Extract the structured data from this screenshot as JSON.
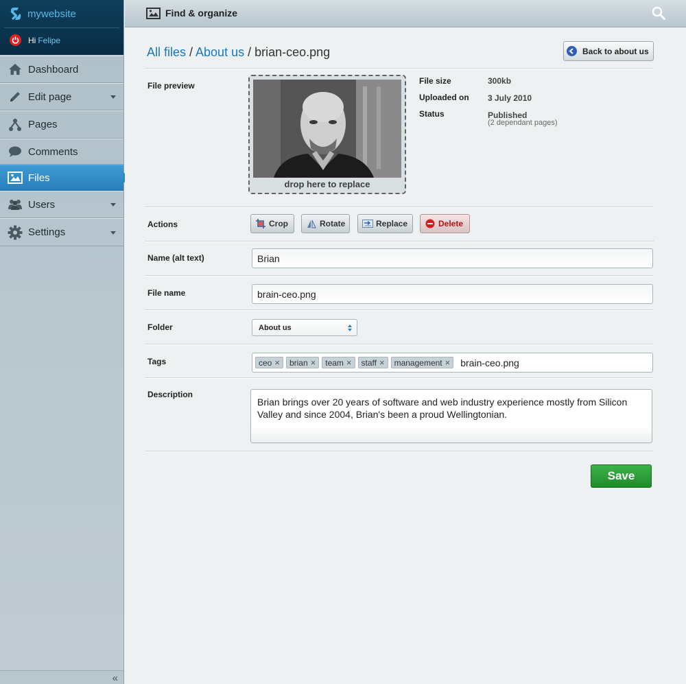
{
  "brand": {
    "name": "mywebsite"
  },
  "user": {
    "greeting": "Hi",
    "name": "Felipe"
  },
  "sidebar": {
    "items": [
      {
        "label": "Dashboard",
        "icon": "home-icon"
      },
      {
        "label": "Edit page",
        "icon": "pencil-icon",
        "has_dropdown": true
      },
      {
        "label": "Pages",
        "icon": "sitemap-icon"
      },
      {
        "label": "Comments",
        "icon": "speech-bubble-icon"
      },
      {
        "label": "Files",
        "icon": "image-icon",
        "active": true
      },
      {
        "label": "Users",
        "icon": "users-icon",
        "has_dropdown": true
      },
      {
        "label": "Settings",
        "icon": "gear-icon",
        "has_dropdown": true
      }
    ],
    "collapse_label": "«"
  },
  "topbar": {
    "title": "Find & organize",
    "icon": "image-icon"
  },
  "breadcrumb": {
    "link1": "All files",
    "sep1": " / ",
    "link2": "About us",
    "sep2": " / ",
    "current": "brian-ceo.png"
  },
  "back_button": {
    "label": "Back to about us"
  },
  "preview": {
    "label": "File preview",
    "drop_text": "drop here to replace"
  },
  "meta": {
    "size_label": "File size",
    "size_value": "300kb",
    "uploaded_label": "Uploaded on",
    "uploaded_value": "3 July 2010",
    "status_label": "Status",
    "status_value": "Published",
    "status_sub": "(2 dependant pages)"
  },
  "actions": {
    "label": "Actions",
    "crop": "Crop",
    "rotate": "Rotate",
    "replace": "Replace",
    "delete": "Delete"
  },
  "form": {
    "name_label": "Name (alt text)",
    "name_value": "Brian",
    "filename_label": "File name",
    "filename_value": "brain-ceo.png",
    "folder_label": "Folder",
    "folder_value": "About us",
    "tags_label": "Tags",
    "tags": [
      "ceo",
      "brian",
      "team",
      "staff",
      "management"
    ],
    "tags_input": "brain-ceo.png",
    "description_label": "Description",
    "description_value": "Brian brings over 20 years of software and web industry experience mostly from Silicon Valley and since 2004, Brian's been a proud Wellingtonian."
  },
  "save_button": {
    "label": "Save"
  },
  "colors": {
    "accent": "#2c84bf",
    "link": "#1b77b8",
    "save": "#2a9a36",
    "delete": "#b01818"
  }
}
